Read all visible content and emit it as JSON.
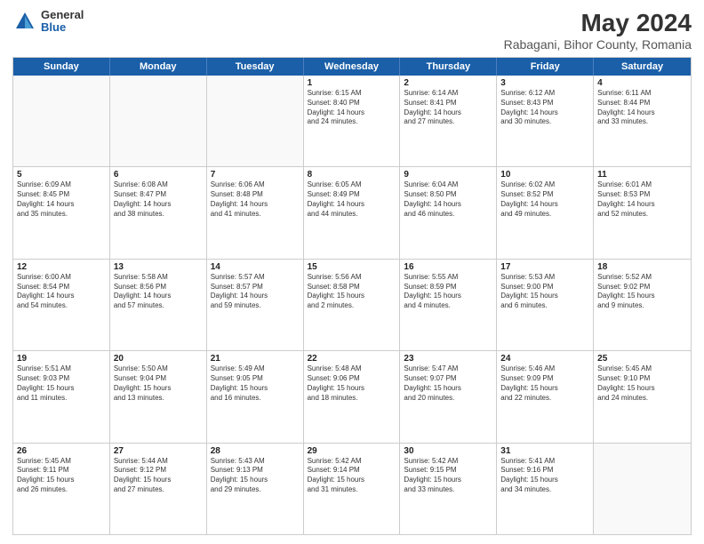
{
  "logo": {
    "general": "General",
    "blue": "Blue"
  },
  "title": "May 2024",
  "subtitle": "Rabagani, Bihor County, Romania",
  "header_days": [
    "Sunday",
    "Monday",
    "Tuesday",
    "Wednesday",
    "Thursday",
    "Friday",
    "Saturday"
  ],
  "weeks": [
    [
      {
        "day": "",
        "lines": []
      },
      {
        "day": "",
        "lines": []
      },
      {
        "day": "",
        "lines": []
      },
      {
        "day": "1",
        "lines": [
          "Sunrise: 6:15 AM",
          "Sunset: 8:40 PM",
          "Daylight: 14 hours",
          "and 24 minutes."
        ]
      },
      {
        "day": "2",
        "lines": [
          "Sunrise: 6:14 AM",
          "Sunset: 8:41 PM",
          "Daylight: 14 hours",
          "and 27 minutes."
        ]
      },
      {
        "day": "3",
        "lines": [
          "Sunrise: 6:12 AM",
          "Sunset: 8:43 PM",
          "Daylight: 14 hours",
          "and 30 minutes."
        ]
      },
      {
        "day": "4",
        "lines": [
          "Sunrise: 6:11 AM",
          "Sunset: 8:44 PM",
          "Daylight: 14 hours",
          "and 33 minutes."
        ]
      }
    ],
    [
      {
        "day": "5",
        "lines": [
          "Sunrise: 6:09 AM",
          "Sunset: 8:45 PM",
          "Daylight: 14 hours",
          "and 35 minutes."
        ]
      },
      {
        "day": "6",
        "lines": [
          "Sunrise: 6:08 AM",
          "Sunset: 8:47 PM",
          "Daylight: 14 hours",
          "and 38 minutes."
        ]
      },
      {
        "day": "7",
        "lines": [
          "Sunrise: 6:06 AM",
          "Sunset: 8:48 PM",
          "Daylight: 14 hours",
          "and 41 minutes."
        ]
      },
      {
        "day": "8",
        "lines": [
          "Sunrise: 6:05 AM",
          "Sunset: 8:49 PM",
          "Daylight: 14 hours",
          "and 44 minutes."
        ]
      },
      {
        "day": "9",
        "lines": [
          "Sunrise: 6:04 AM",
          "Sunset: 8:50 PM",
          "Daylight: 14 hours",
          "and 46 minutes."
        ]
      },
      {
        "day": "10",
        "lines": [
          "Sunrise: 6:02 AM",
          "Sunset: 8:52 PM",
          "Daylight: 14 hours",
          "and 49 minutes."
        ]
      },
      {
        "day": "11",
        "lines": [
          "Sunrise: 6:01 AM",
          "Sunset: 8:53 PM",
          "Daylight: 14 hours",
          "and 52 minutes."
        ]
      }
    ],
    [
      {
        "day": "12",
        "lines": [
          "Sunrise: 6:00 AM",
          "Sunset: 8:54 PM",
          "Daylight: 14 hours",
          "and 54 minutes."
        ]
      },
      {
        "day": "13",
        "lines": [
          "Sunrise: 5:58 AM",
          "Sunset: 8:56 PM",
          "Daylight: 14 hours",
          "and 57 minutes."
        ]
      },
      {
        "day": "14",
        "lines": [
          "Sunrise: 5:57 AM",
          "Sunset: 8:57 PM",
          "Daylight: 14 hours",
          "and 59 minutes."
        ]
      },
      {
        "day": "15",
        "lines": [
          "Sunrise: 5:56 AM",
          "Sunset: 8:58 PM",
          "Daylight: 15 hours",
          "and 2 minutes."
        ]
      },
      {
        "day": "16",
        "lines": [
          "Sunrise: 5:55 AM",
          "Sunset: 8:59 PM",
          "Daylight: 15 hours",
          "and 4 minutes."
        ]
      },
      {
        "day": "17",
        "lines": [
          "Sunrise: 5:53 AM",
          "Sunset: 9:00 PM",
          "Daylight: 15 hours",
          "and 6 minutes."
        ]
      },
      {
        "day": "18",
        "lines": [
          "Sunrise: 5:52 AM",
          "Sunset: 9:02 PM",
          "Daylight: 15 hours",
          "and 9 minutes."
        ]
      }
    ],
    [
      {
        "day": "19",
        "lines": [
          "Sunrise: 5:51 AM",
          "Sunset: 9:03 PM",
          "Daylight: 15 hours",
          "and 11 minutes."
        ]
      },
      {
        "day": "20",
        "lines": [
          "Sunrise: 5:50 AM",
          "Sunset: 9:04 PM",
          "Daylight: 15 hours",
          "and 13 minutes."
        ]
      },
      {
        "day": "21",
        "lines": [
          "Sunrise: 5:49 AM",
          "Sunset: 9:05 PM",
          "Daylight: 15 hours",
          "and 16 minutes."
        ]
      },
      {
        "day": "22",
        "lines": [
          "Sunrise: 5:48 AM",
          "Sunset: 9:06 PM",
          "Daylight: 15 hours",
          "and 18 minutes."
        ]
      },
      {
        "day": "23",
        "lines": [
          "Sunrise: 5:47 AM",
          "Sunset: 9:07 PM",
          "Daylight: 15 hours",
          "and 20 minutes."
        ]
      },
      {
        "day": "24",
        "lines": [
          "Sunrise: 5:46 AM",
          "Sunset: 9:09 PM",
          "Daylight: 15 hours",
          "and 22 minutes."
        ]
      },
      {
        "day": "25",
        "lines": [
          "Sunrise: 5:45 AM",
          "Sunset: 9:10 PM",
          "Daylight: 15 hours",
          "and 24 minutes."
        ]
      }
    ],
    [
      {
        "day": "26",
        "lines": [
          "Sunrise: 5:45 AM",
          "Sunset: 9:11 PM",
          "Daylight: 15 hours",
          "and 26 minutes."
        ]
      },
      {
        "day": "27",
        "lines": [
          "Sunrise: 5:44 AM",
          "Sunset: 9:12 PM",
          "Daylight: 15 hours",
          "and 27 minutes."
        ]
      },
      {
        "day": "28",
        "lines": [
          "Sunrise: 5:43 AM",
          "Sunset: 9:13 PM",
          "Daylight: 15 hours",
          "and 29 minutes."
        ]
      },
      {
        "day": "29",
        "lines": [
          "Sunrise: 5:42 AM",
          "Sunset: 9:14 PM",
          "Daylight: 15 hours",
          "and 31 minutes."
        ]
      },
      {
        "day": "30",
        "lines": [
          "Sunrise: 5:42 AM",
          "Sunset: 9:15 PM",
          "Daylight: 15 hours",
          "and 33 minutes."
        ]
      },
      {
        "day": "31",
        "lines": [
          "Sunrise: 5:41 AM",
          "Sunset: 9:16 PM",
          "Daylight: 15 hours",
          "and 34 minutes."
        ]
      },
      {
        "day": "",
        "lines": []
      }
    ]
  ]
}
